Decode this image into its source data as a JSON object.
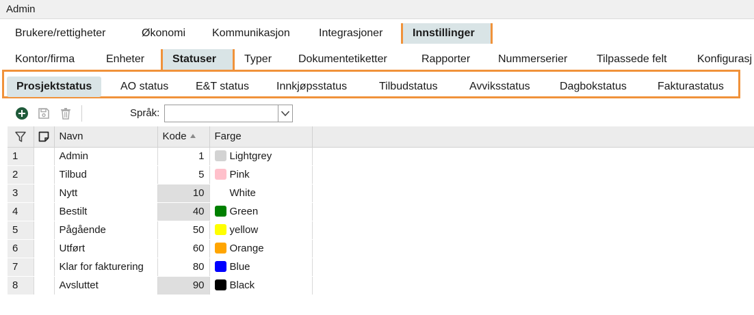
{
  "window": {
    "title": "Admin"
  },
  "tabs_level1": [
    {
      "label": "Brukere/rettigheter"
    },
    {
      "label": "Økonomi"
    },
    {
      "label": "Kommunikasjon"
    },
    {
      "label": "Integrasjoner"
    },
    {
      "label": "Innstillinger",
      "active": true
    }
  ],
  "tabs_level2": [
    {
      "label": "Kontor/firma"
    },
    {
      "label": "Enheter"
    },
    {
      "label": "Statuser",
      "active": true
    },
    {
      "label": "Typer"
    },
    {
      "label": "Dokumentetiketter"
    },
    {
      "label": "Rapporter"
    },
    {
      "label": "Nummerserier"
    },
    {
      "label": "Tilpassede felt"
    },
    {
      "label": "Konfigurasj"
    }
  ],
  "tabs_level3": [
    {
      "label": "Prosjektstatus",
      "active": true
    },
    {
      "label": "AO status"
    },
    {
      "label": "E&T status"
    },
    {
      "label": "Innkjøpsstatus"
    },
    {
      "label": "Tilbudstatus"
    },
    {
      "label": "Avviksstatus"
    },
    {
      "label": "Dagbokstatus"
    },
    {
      "label": "Fakturastatus"
    }
  ],
  "toolbar": {
    "add_icon": "plus-circle-icon",
    "save_icon": "floppy-disk-icon",
    "delete_icon": "trash-icon",
    "language_label": "Språk:",
    "language_value": ""
  },
  "table": {
    "columns": {
      "filter_icon": "filter-icon",
      "note_icon": "note-icon",
      "name": "Navn",
      "code": "Kode",
      "color": "Farge"
    },
    "sort": {
      "column": "Kode",
      "direction": "ascending"
    },
    "rows": [
      {
        "num": "1",
        "name": "Admin",
        "code": "1",
        "color_name": "Lightgrey",
        "swatch": "#d3d3d3",
        "shaded": false
      },
      {
        "num": "2",
        "name": "Tilbud",
        "code": "5",
        "color_name": "Pink",
        "swatch": "#ffc0cb",
        "shaded": false
      },
      {
        "num": "3",
        "name": "Nytt",
        "code": "10",
        "color_name": "White",
        "swatch": "#ffffff",
        "shaded": true
      },
      {
        "num": "4",
        "name": "Bestilt",
        "code": "40",
        "color_name": "Green",
        "swatch": "#008000",
        "shaded": true
      },
      {
        "num": "5",
        "name": "Pågående",
        "code": "50",
        "color_name": "yellow",
        "swatch": "#ffff00",
        "shaded": false
      },
      {
        "num": "6",
        "name": "Utført",
        "code": "60",
        "color_name": "Orange",
        "swatch": "#ffa500",
        "shaded": false
      },
      {
        "num": "7",
        "name": "Klar for fakturering",
        "code": "80",
        "color_name": "Blue",
        "swatch": "#0000ff",
        "shaded": false
      },
      {
        "num": "8",
        "name": "Avsluttet",
        "code": "90",
        "color_name": "Black",
        "swatch": "#000000",
        "shaded": true
      }
    ]
  },
  "colors": {
    "highlight_border": "#f0923a",
    "active_tab_bg": "#d9e4e6",
    "add_button": "#1f5a3a"
  }
}
